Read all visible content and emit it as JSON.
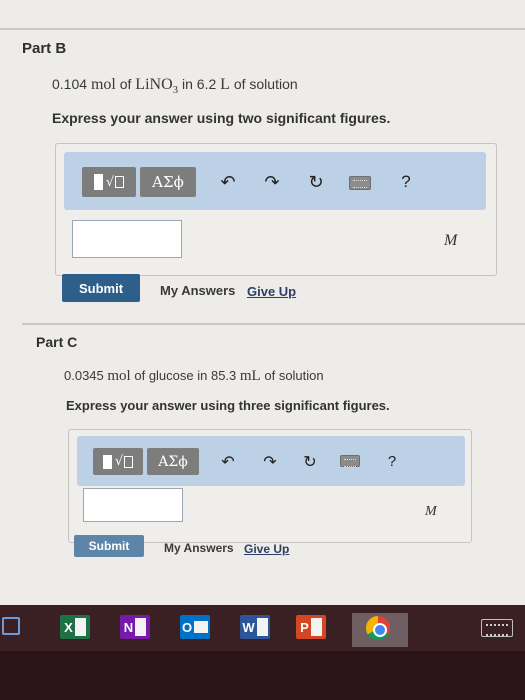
{
  "parts": [
    {
      "title": "Part B",
      "question": {
        "amount": "0.104",
        "unit1": "mol",
        "of1": "of",
        "formula_main": "LiNO",
        "formula_sub": "3",
        "in_text": "in 6.2",
        "unit2": "L",
        "of2": "of solution"
      },
      "instruction": "Express your answer using two significant figures.",
      "toolbar": {
        "symbols_label": "ΑΣϕ",
        "help_label": "?"
      },
      "answer_value": "",
      "unit_label": "M",
      "submit_label": "Submit",
      "my_answers_label": "My Answers",
      "give_up_label": "Give Up"
    },
    {
      "title": "Part C",
      "question": {
        "amount": "0.0345",
        "unit1": "mol",
        "of1": "of glucose in 85.3",
        "unit2": "mL",
        "of2": "of solution"
      },
      "instruction": "Express your answer using three significant figures.",
      "toolbar": {
        "symbols_label": "ΑΣϕ",
        "help_label": "?"
      },
      "answer_value": "",
      "unit_label": "M",
      "submit_label": "Submit",
      "my_answers_label": "My Answers",
      "give_up_label": "Give Up"
    }
  ],
  "taskbar": {
    "apps": [
      {
        "name": "excel",
        "label": "X",
        "color": "#1e7145"
      },
      {
        "name": "onenote",
        "label": "N",
        "color": "#7719aa"
      },
      {
        "name": "outlook",
        "label": "O",
        "color": "#0072c6"
      },
      {
        "name": "word",
        "label": "W",
        "color": "#2b579a"
      },
      {
        "name": "powerpoint",
        "label": "P",
        "color": "#d24726"
      },
      {
        "name": "chrome",
        "label": "",
        "color": "#4285f4"
      }
    ]
  }
}
